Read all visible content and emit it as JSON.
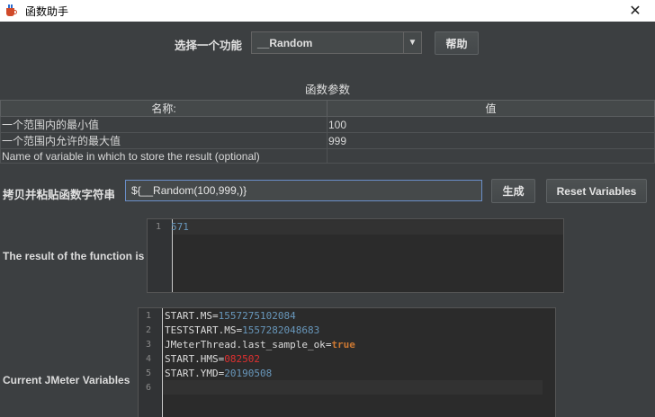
{
  "window": {
    "title": "函数助手"
  },
  "function_select": {
    "label": "选择一个功能",
    "value": "__Random",
    "help_label": "帮助"
  },
  "params": {
    "title": "函数参数",
    "headers": [
      "名称:",
      "值"
    ],
    "rows": [
      {
        "name": "一个范围内的最小值",
        "value": "100"
      },
      {
        "name": "一个范围内允许的最大值",
        "value": "999"
      },
      {
        "name": "Name of variable in which to store the result (optional)",
        "value": ""
      }
    ]
  },
  "copy": {
    "label": "拷贝并粘贴函数字符串",
    "value": "${__Random(100,999,)}",
    "generate_label": "生成",
    "reset_label": "Reset Variables"
  },
  "result": {
    "label": "The result of the function is",
    "lines": [
      {
        "no": "1",
        "value": "571"
      }
    ]
  },
  "variables": {
    "label": "Current JMeter Variables",
    "lines": [
      {
        "no": "1",
        "key": "START.MS",
        "value": "1557275102084"
      },
      {
        "no": "2",
        "key": "TESTSTART.MS",
        "value": "1557282048683"
      },
      {
        "no": "3",
        "key": "JMeterThread.last_sample_ok",
        "value": "true"
      },
      {
        "no": "4",
        "key": "START.HMS",
        "value": "082502"
      },
      {
        "no": "5",
        "key": "START.YMD",
        "value": "20190508"
      },
      {
        "no": "6",
        "key": "",
        "value": ""
      }
    ]
  },
  "colors": {
    "background": "#3c3f41",
    "editor_bg": "#2b2b2b",
    "number": "#6897bb",
    "keyword": "#cc7832",
    "highlight": "#e03030",
    "focus_border": "#6a8ec8"
  }
}
